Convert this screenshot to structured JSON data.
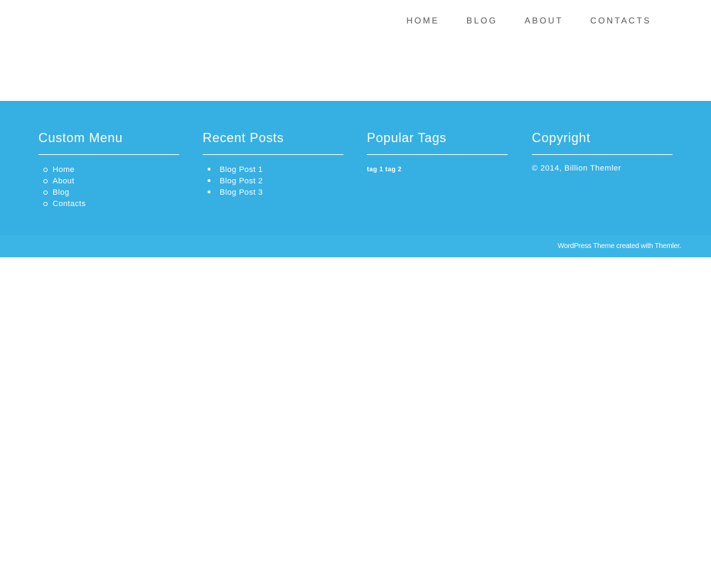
{
  "nav": {
    "items": [
      {
        "label": "HOME"
      },
      {
        "label": "BLOG"
      },
      {
        "label": "ABOUT"
      },
      {
        "label": "CONTACTS"
      }
    ]
  },
  "footer": {
    "custom_menu": {
      "title": "Custom Menu",
      "items": [
        "Home",
        "About",
        "Blog",
        "Contacts"
      ]
    },
    "recent_posts": {
      "title": "Recent Posts",
      "items": [
        "Blog Post 1",
        "Blog Post 2",
        "Blog Post 3"
      ]
    },
    "popular_tags": {
      "title": "Popular Tags",
      "tags": [
        "tag 1",
        "tag 2"
      ]
    },
    "copyright": {
      "title": "Copyright",
      "text": "© 2014, Billion Themler"
    },
    "credit": "WordPress Theme created with Themler."
  },
  "colors": {
    "footer_bg": "#36afe3",
    "bottom_bar_bg": "#3bb4e6",
    "nav_text": "#555555"
  }
}
